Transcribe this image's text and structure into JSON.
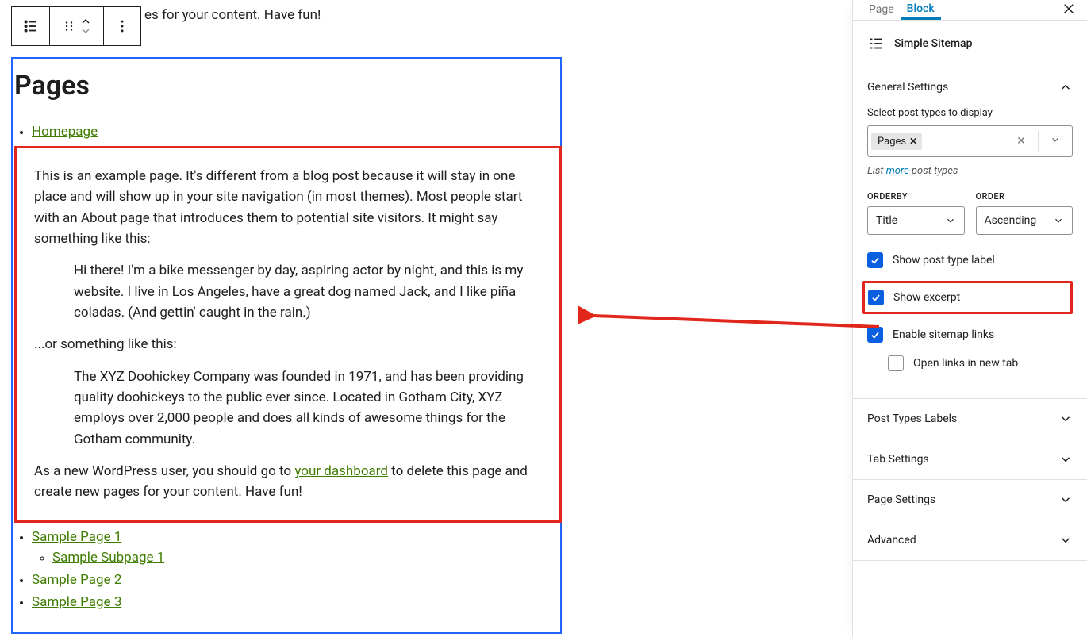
{
  "floating_toolbar": {
    "block_type": "list",
    "mover": "drag-move",
    "options": "options"
  },
  "truncated_text": "es for your content. Have fun!",
  "block": {
    "heading": "Pages",
    "links": {
      "homepage": "Homepage",
      "sample1": "Sample Page 1",
      "subpage1": "Sample Subpage 1",
      "sample2": "Sample Page 2",
      "sample3": "Sample Page 3"
    },
    "excerpt": {
      "p1": "This is an example page. It's different from a blog post because it will stay in one place and will show up in your site navigation (in most themes). Most people start with an About page that introduces them to potential site visitors. It might say something like this:",
      "q1": "Hi there! I'm a bike messenger by day, aspiring actor by night, and this is my website. I live in Los Angeles, have a great dog named Jack, and I like piña coladas. (And gettin' caught in the rain.)",
      "p2": "...or something like this:",
      "q2": "The XYZ Doohickey Company was founded in 1971, and has been providing quality doohickeys to the public ever since. Located in Gotham City, XYZ employs over 2,000 people and does all kinds of awesome things for the Gotham community.",
      "p3a": "As a new WordPress user, you should go to ",
      "dash": "your dashboard",
      "p3b": " to delete this page and create new pages for your content. Have fun!"
    }
  },
  "sidebar": {
    "tabs": {
      "page": "Page",
      "block": "Block"
    },
    "block_name": "Simple Sitemap",
    "panels": {
      "general": {
        "title": "General Settings",
        "post_types_label": "Select post types to display",
        "token": "Pages",
        "list_prefix": "List ",
        "list_link": "more",
        "list_suffix": " post types",
        "orderby_label": "ORDERBY",
        "orderby_value": "Title",
        "order_label": "ORDER",
        "order_value": "Ascending",
        "toggle_show_label": "Show post type label",
        "toggle_excerpt": "Show excerpt",
        "toggle_links": "Enable sitemap links",
        "toggle_newtab": "Open links in new tab"
      },
      "post_types_labels": "Post Types Labels",
      "tab_settings": "Tab Settings",
      "page_settings": "Page Settings",
      "advanced": "Advanced"
    }
  }
}
